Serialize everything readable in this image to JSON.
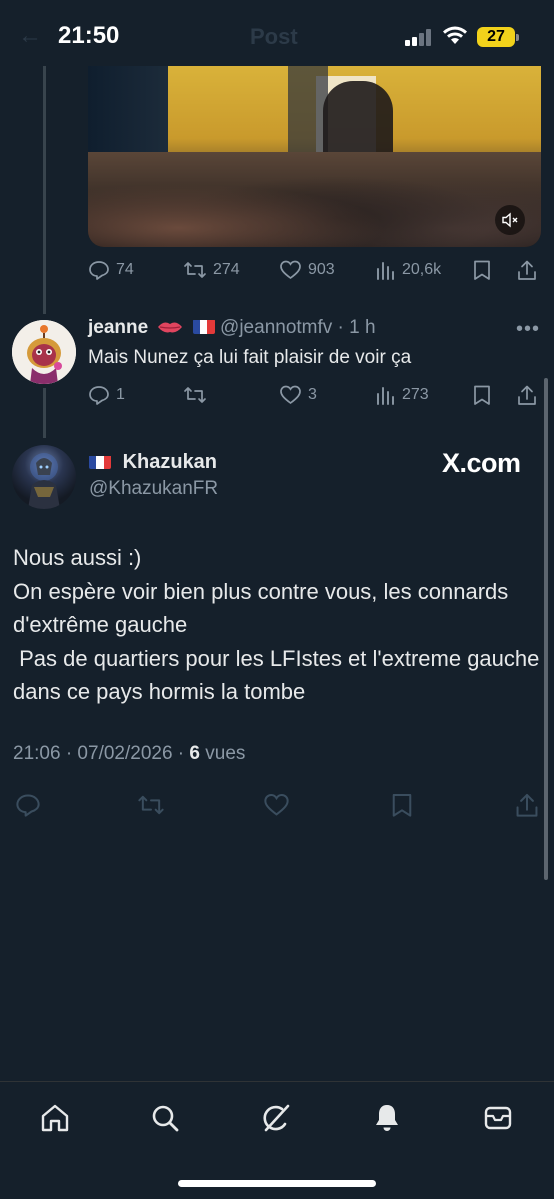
{
  "status_bar": {
    "time": "21:50",
    "battery": "27",
    "faded_title": "Post"
  },
  "quoted_video_tweet": {
    "actions": {
      "replies": "74",
      "reposts": "274",
      "likes": "903",
      "views": "20,6k"
    }
  },
  "reply_tweet": {
    "name": "jeanne",
    "handle": "@jeannotmfv",
    "time": "1 h",
    "text": "Mais Nunez ça lui fait plaisir de voir ça",
    "actions": {
      "replies": "1",
      "reposts": "",
      "likes": "3",
      "views": "273"
    }
  },
  "main_tweet": {
    "name": "Khazukan",
    "handle": "@KhazukanFR",
    "watermark": "X.com",
    "body": "Nous aussi :)\nOn espère voir bien plus contre vous, les connards d'extrême gauche\n Pas de quartiers pour les LFIstes et l'extreme gauche dans ce pays hormis la tombe",
    "timestamp": "21:06 · 07/02/2026 · ",
    "views_count": "6",
    "views_label": " vues"
  },
  "bottom_nav": [
    "home-icon",
    "search-icon",
    "grok-icon",
    "notifications-icon",
    "messages-icon"
  ],
  "colors": {
    "background": "#15202b",
    "text": "#e7e9ea",
    "muted": "#8b98a5",
    "battery": "#f2d21b"
  }
}
